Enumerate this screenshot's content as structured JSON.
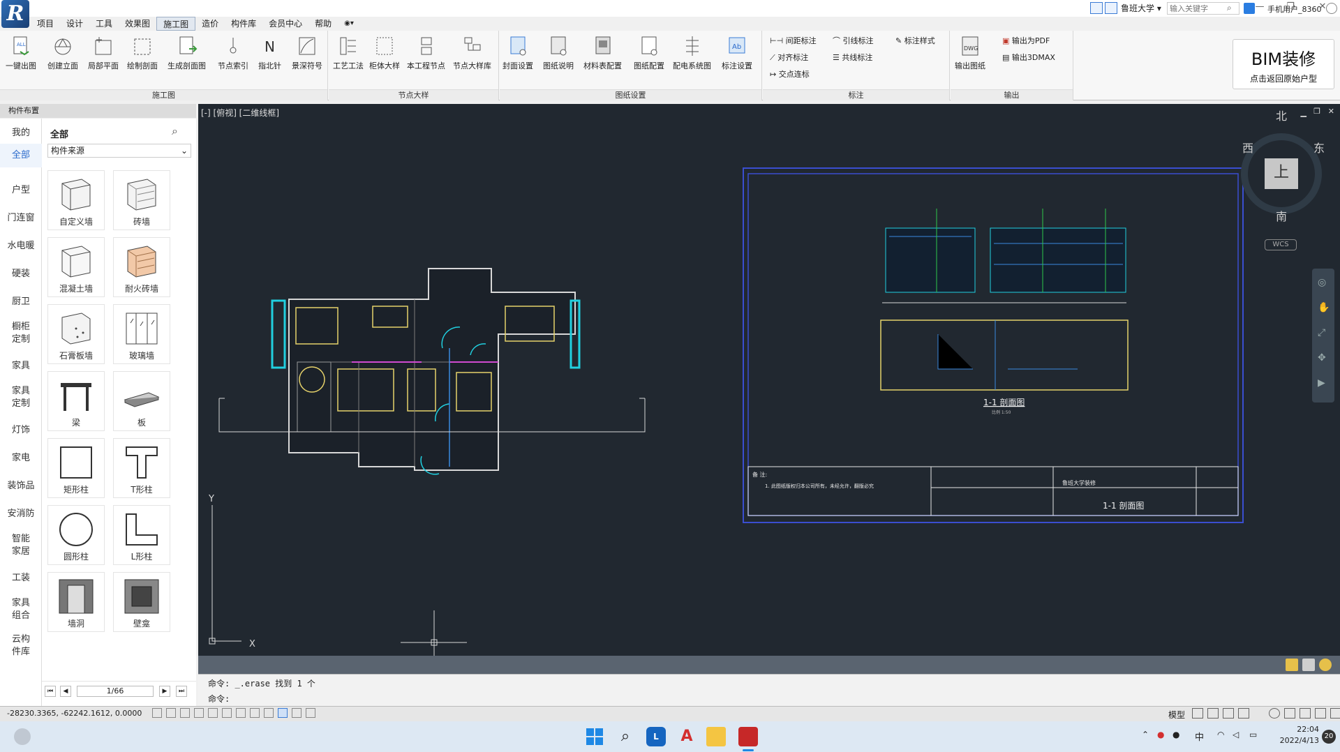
{
  "menu": [
    "项目",
    "设计",
    "工具",
    "效果图",
    "施工图",
    "造价",
    "构件库",
    "会员中心",
    "帮助"
  ],
  "active_menu_index": 4,
  "titlebar": {
    "org": "鲁班大学",
    "search_placeholder": "输入关键字",
    "user": "手机用户_8360"
  },
  "ribbon": {
    "groups": [
      {
        "label": "施工图",
        "buttons": [
          "一键出图",
          "创建立面",
          "局部平面",
          "绘制剖面",
          "生成剖面图",
          "节点索引",
          "指北针",
          "景深符号"
        ]
      },
      {
        "label": "节点大样",
        "buttons": [
          "工艺工法",
          "柜体大样",
          "本工程节点",
          "节点大样库"
        ]
      },
      {
        "label": "图纸设置",
        "buttons": [
          "封面设置",
          "图纸说明",
          "材料表配置",
          "图纸配置",
          "配电系统图",
          "标注设置"
        ]
      },
      {
        "label": "标注",
        "small": [
          "间距标注",
          "对齐标注",
          "交点连标",
          "引线标注",
          "共线标注",
          "标注样式"
        ]
      },
      {
        "label": "输出",
        "buttons": [
          "输出图纸"
        ],
        "small": [
          "输出为PDF",
          "输出3DMAX"
        ]
      }
    ],
    "bim_title": "BIM装修",
    "bim_sub": "点击返回原始户型"
  },
  "sidebar": {
    "header": "构件布置",
    "categories": [
      "我的",
      "全部",
      "户型",
      "门连窗",
      "水电暖",
      "硬装",
      "厨卫",
      "橱柜定制",
      "家具",
      "家具定制",
      "灯饰",
      "家电",
      "装饰品",
      "安消防",
      "智能家居",
      "工装",
      "家具组合",
      "云构件库"
    ],
    "active_category": 1,
    "panel_title": "全部",
    "source_select": "构件来源",
    "items": [
      "自定义墙",
      "砖墙",
      "混凝土墙",
      "耐火砖墙",
      "石膏板墙",
      "玻璃墙",
      "梁",
      "板",
      "矩形柱",
      "T形柱",
      "圆形柱",
      "L形柱",
      "墙洞",
      "壁龛"
    ],
    "page": "1/66"
  },
  "viewport": {
    "label": "[-] [俯视] [二维线框]",
    "compass": {
      "n": "北",
      "s": "南",
      "e": "东",
      "w": "西",
      "top": "上",
      "wcs": "WCS"
    },
    "drawing": {
      "section_title": "1-1 剖面图",
      "scale": "比例 1:50",
      "note_label": "备 注:",
      "note_text": "1. 此图纸版权归本公司所有，未经允许，翻版必究",
      "titleblock_name": "1-1 剖面图",
      "titleblock_project": "鲁班大学装修"
    },
    "axis": {
      "x": "X",
      "y": "Y"
    }
  },
  "command": {
    "history": "命令: _.erase 找到 1 个",
    "prompt": "命令:"
  },
  "status": {
    "coords": "-28230.3365, -62242.1612, 0.0000",
    "model": "模型"
  },
  "taskbar": {
    "ime": "中",
    "time": "22:04",
    "date": "2022/4/13",
    "badge": "20"
  }
}
